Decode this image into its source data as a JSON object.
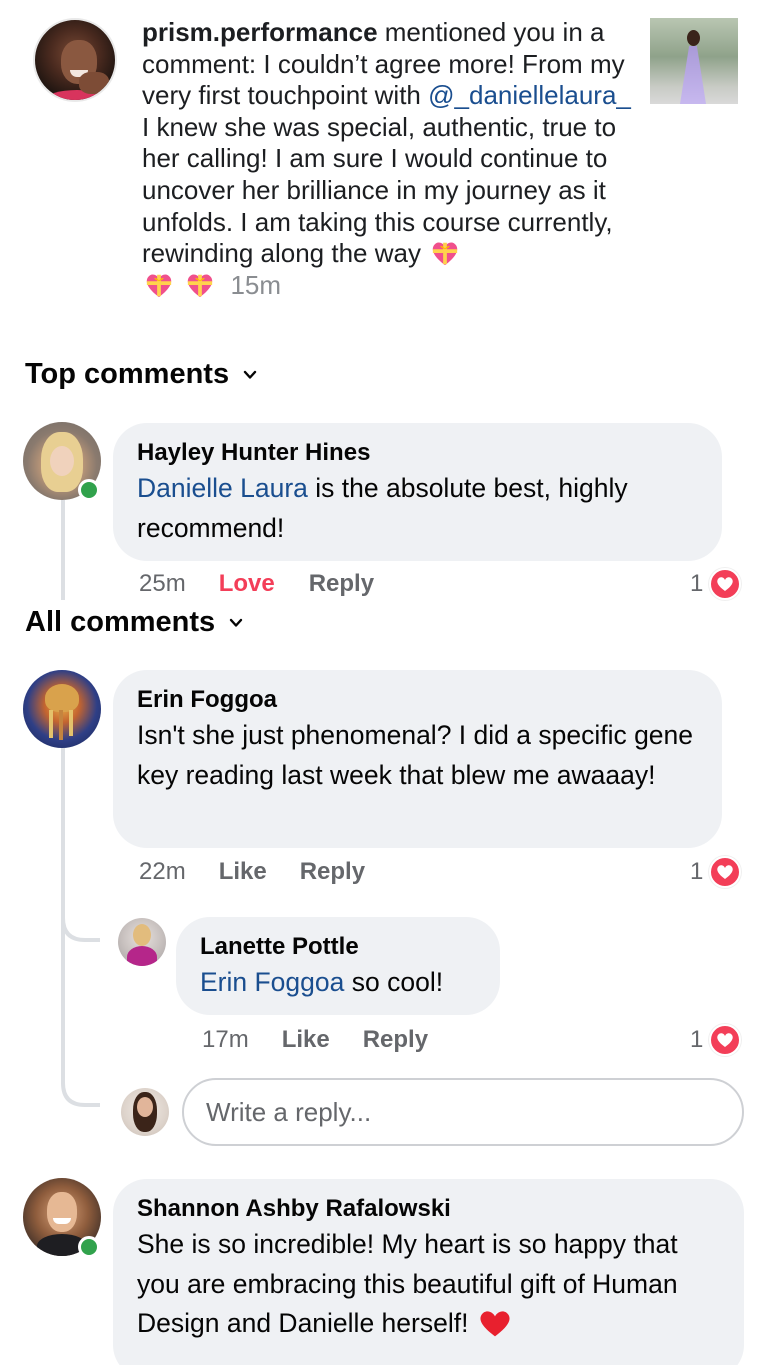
{
  "notification": {
    "username": "prism.performance",
    "text_part1": " mentioned you in a comment: I couldn’t agree more! From my very first touchpoint with ",
    "mention": "@_daniellelaura_",
    "text_part2": " I knew she was special, authentic, true to her calling! I am sure I would continue to uncover her brilliance in my journey as it unfolds. I am taking this course currently, rewinding along the way",
    "time": "15m",
    "emoji": "heart-with-ribbon"
  },
  "sections": {
    "top_comments": "Top comments",
    "all_comments": "All comments"
  },
  "top_comment": {
    "author": "Hayley Hunter Hines",
    "mention": "Danielle Laura",
    "text": " is the absolute best, highly recommend!",
    "time": "25m",
    "reaction_label": "Love",
    "reply_label": "Reply",
    "reaction_count": "1"
  },
  "comments": [
    {
      "author": "Erin Foggoa",
      "text": "Isn't she just phenomenal? I did a specific gene key reading last week that blew me awaaay!",
      "time": "22m",
      "like_label": "Like",
      "reply_label": "Reply",
      "reaction_count": "1"
    }
  ],
  "reply": {
    "author": "Lanette Pottle",
    "mention": "Erin Foggoa",
    "text": " so cool!",
    "time": "17m",
    "like_label": "Like",
    "reply_label": "Reply",
    "reaction_count": "1"
  },
  "reply_input": {
    "placeholder": "Write a reply..."
  },
  "last_comment": {
    "author": "Shannon Ashby Rafalowski",
    "text": "She is so incredible! My heart is so happy that you are embracing this beautiful gift of Human Design and Danielle herself!"
  },
  "colors": {
    "link": "#1a4e8f",
    "love": "#f33e58",
    "online": "#31a24c",
    "bubble": "#eff1f4"
  }
}
